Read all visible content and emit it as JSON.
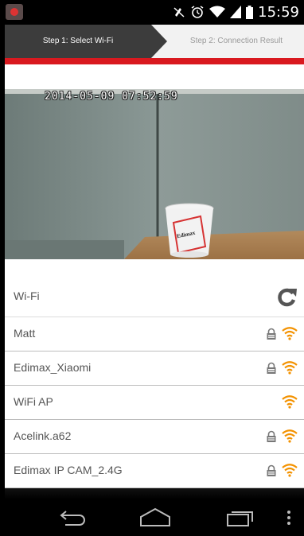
{
  "status_bar": {
    "time": "15:59",
    "icons": [
      "app-notification-icon",
      "mute-icon",
      "alarm-icon",
      "wifi-icon",
      "cell-signal-icon",
      "battery-icon"
    ]
  },
  "steps": {
    "step1_label": "Step 1: Select Wi-Fi",
    "step2_label": "Step 2: Connection Result",
    "active_color": "#3c3c3c",
    "accent_color": "#d9191f"
  },
  "camera": {
    "timestamp": "2014-05-09 07:52:59",
    "cup_brand": "Edimax"
  },
  "wifi": {
    "title": "Wi-Fi",
    "refresh_icon": "refresh-icon",
    "signal_color": "#f39200",
    "networks": [
      {
        "ssid": "Matt",
        "locked": true
      },
      {
        "ssid": "Edimax_Xiaomi",
        "locked": true
      },
      {
        "ssid": "WiFi AP",
        "locked": false
      },
      {
        "ssid": "Acelink.a62",
        "locked": true
      },
      {
        "ssid": "Edimax IP CAM_2.4G",
        "locked": true
      }
    ]
  },
  "nav_bar": {
    "buttons": [
      "back-icon",
      "home-icon",
      "recent-apps-icon",
      "overflow-menu-icon"
    ]
  }
}
